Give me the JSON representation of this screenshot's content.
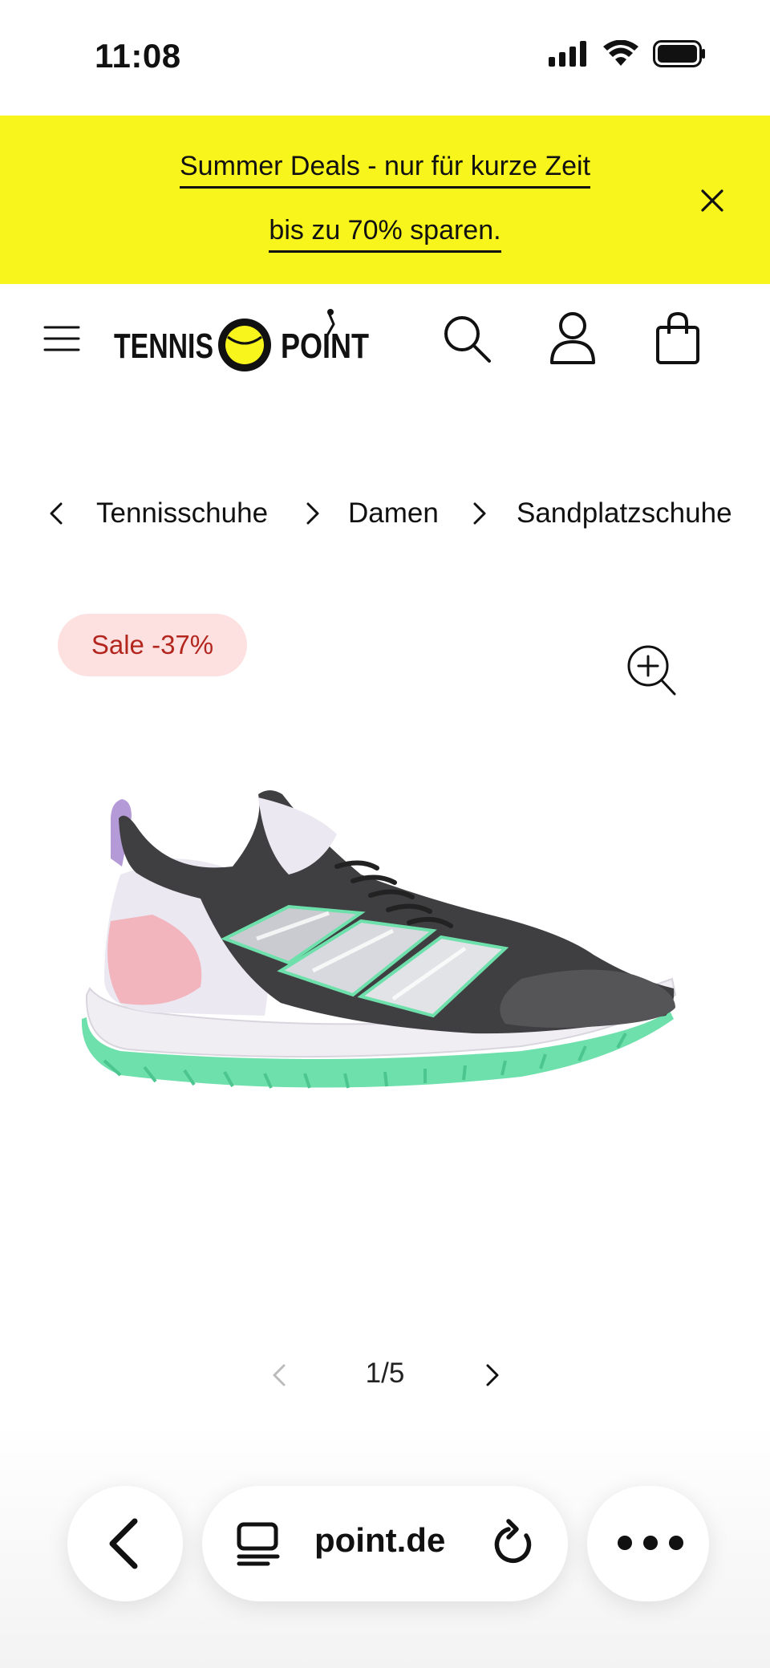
{
  "status_bar": {
    "time": "11:08"
  },
  "promo": {
    "line1": "Summer Deals - nur für kurze Zeit",
    "line2": "bis zu 70% sparen.",
    "background": "#f8f51c"
  },
  "header": {
    "logo_left": "TENNIS",
    "logo_right": "POINT",
    "icons": [
      "menu-icon",
      "search-icon",
      "account-icon",
      "bag-icon"
    ]
  },
  "breadcrumb": {
    "items": [
      "Tennisschuhe",
      "Damen",
      "Sandplatzschuhe"
    ]
  },
  "product": {
    "sale_badge": "Sale -37%",
    "sale_color": "#b3261e"
  },
  "pager": {
    "count": "1/5"
  },
  "browser": {
    "url": "point.de",
    "url_prefix_faded": ""
  }
}
